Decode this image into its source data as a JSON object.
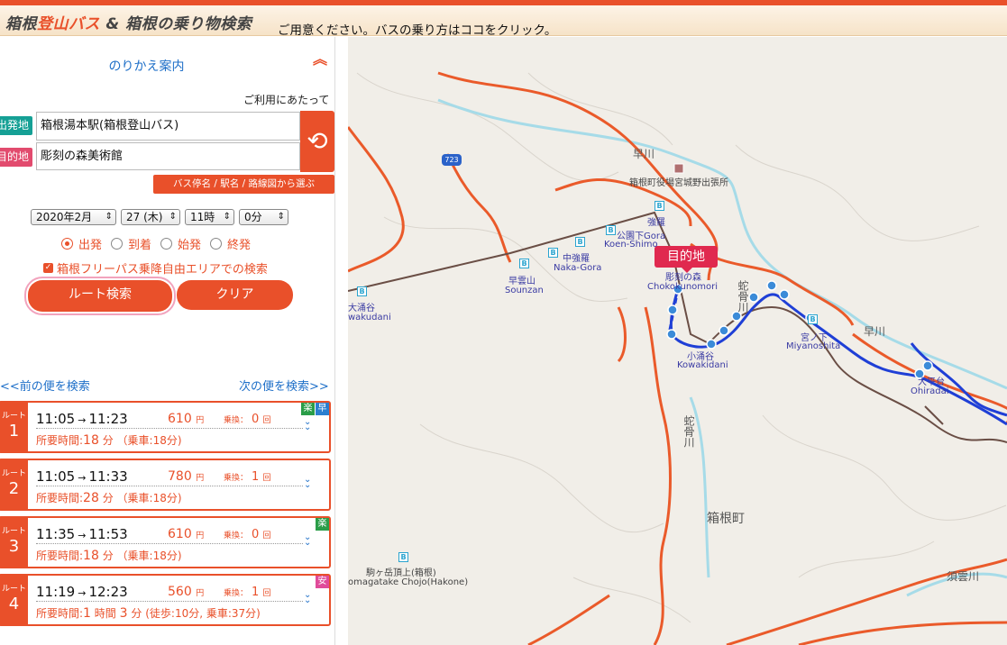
{
  "header": {
    "logo_part1": "箱根",
    "logo_part2": "登山バス",
    "logo_part3": " & 箱根の乗り物検索",
    "notice": "ご用意ください。バスの乗り方はココをクリック。"
  },
  "panel": {
    "title": "のりかえ案内",
    "collapse_glyph": "︽",
    "usage_link": "ご利用にあたって",
    "from_label": "出発地",
    "from_value": "箱根湯本駅(箱根登山バス)",
    "to_label": "目的地",
    "to_value": "彫刻の森美術館",
    "swap_glyph": "⟲",
    "select_link": "バス停名 / 駅名 / 路線図から選ぶ",
    "date": {
      "year_month": "2020年2月",
      "day": "27 (木)",
      "hour": "11時",
      "minute": "0分"
    },
    "radios": [
      {
        "label": "出発",
        "selected": true
      },
      {
        "label": "到着",
        "selected": false
      },
      {
        "label": "始発",
        "selected": false
      },
      {
        "label": "終発",
        "selected": false
      }
    ],
    "freepass_check": "箱根フリーパス乗降自由エリアでの検索",
    "search_button": "ルート検索",
    "clear_button": "クリア",
    "prev_link": "<<前の便を検索",
    "next_link": "次の便を検索>>"
  },
  "routes": [
    {
      "label": "ルート",
      "num": "1",
      "dep": "11:05",
      "arr": "11:23",
      "fare": "610",
      "fare_unit": "円",
      "xfer_label": "乗換：",
      "xfer": "0",
      "xfer_unit": "回",
      "dur_label": "所要時間:",
      "dur": "18",
      "dur_unit": "分",
      "detail": "（乗車:18分)",
      "badges": [
        {
          "t": "楽",
          "c": "#2a9d48"
        },
        {
          "t": "早",
          "c": "#2b7fd0"
        }
      ]
    },
    {
      "label": "ルート",
      "num": "2",
      "dep": "11:05",
      "arr": "11:33",
      "fare": "780",
      "fare_unit": "円",
      "xfer_label": "乗換：",
      "xfer": "1",
      "xfer_unit": "回",
      "dur_label": "所要時間:",
      "dur": "28",
      "dur_unit": "分",
      "detail": "（乗車:18分)",
      "badges": []
    },
    {
      "label": "ルート",
      "num": "3",
      "dep": "11:35",
      "arr": "11:53",
      "fare": "610",
      "fare_unit": "円",
      "xfer_label": "乗換：",
      "xfer": "0",
      "xfer_unit": "回",
      "dur_label": "所要時間:",
      "dur": "18",
      "dur_unit": "分",
      "detail": "（乗車:18分)",
      "badges": [
        {
          "t": "楽",
          "c": "#2a9d48"
        }
      ]
    },
    {
      "label": "ルート",
      "num": "4",
      "dep": "11:19",
      "arr": "12:23",
      "fare": "560",
      "fare_unit": "円",
      "xfer_label": "乗換：",
      "xfer": "1",
      "xfer_unit": "回",
      "dur_label": "所要時間:",
      "dur": "1",
      "dur_unit": "時間",
      "dur2": "3",
      "dur2_unit": "分",
      "detail": "(徒歩:10分, 乗車:37分)",
      "badges": [
        {
          "t": "安",
          "c": "#e04b9a"
        }
      ]
    }
  ],
  "map": {
    "destination_pin": "目的地",
    "town_label": "箱根町",
    "road_number": "723",
    "labels": [
      {
        "t": "箱根町役場宮城野出張所",
        "k": "lbl2"
      },
      {
        "t": "強羅",
        "k": "lbl"
      },
      {
        "t": "公園下Gora",
        "k": "lbl"
      },
      {
        "t": "Koen-Shimo",
        "k": "lbl"
      },
      {
        "t": "中強羅",
        "k": "lbl"
      },
      {
        "t": "Naka-Gora",
        "k": "lbl"
      },
      {
        "t": "早雲山",
        "k": "lbl"
      },
      {
        "t": "Sounzan",
        "k": "lbl"
      },
      {
        "t": "大涌谷",
        "k": "lbl"
      },
      {
        "t": "wakudani",
        "k": "lbl"
      },
      {
        "t": "彫刻の森",
        "k": "lbl"
      },
      {
        "t": "Chokokunomori",
        "k": "lbl"
      },
      {
        "t": "小涌谷",
        "k": "lbl"
      },
      {
        "t": "Kowakidani",
        "k": "lbl"
      },
      {
        "t": "宮ノ下",
        "k": "lbl"
      },
      {
        "t": "Miyanoshita",
        "k": "lbl"
      },
      {
        "t": "大平台",
        "k": "lbl"
      },
      {
        "t": "Ohiradai",
        "k": "lbl"
      },
      {
        "t": "駒ヶ岳頂上(箱根)",
        "k": "lbl2"
      },
      {
        "t": "omagatake Chojo(Hakone)",
        "k": "lbl2"
      }
    ],
    "rivers": [
      "早川",
      "早川",
      "蛇骨川",
      "須雲川"
    ]
  }
}
